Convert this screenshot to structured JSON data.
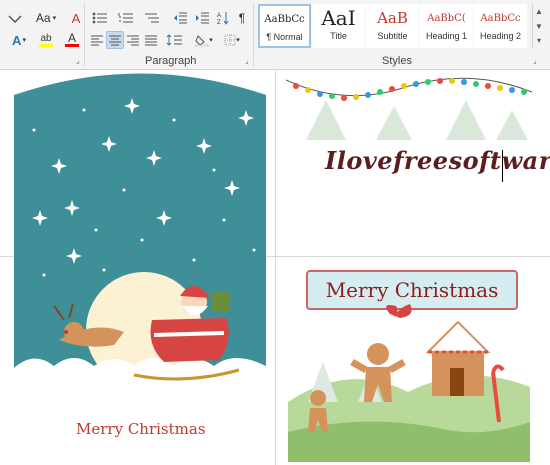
{
  "ribbon": {
    "font": {
      "change_case": "Aa",
      "clear_format_label": "A",
      "text_effects_label": "A",
      "highlight_label": "ab",
      "font_color_label": "A"
    },
    "paragraph": {
      "label": "Paragraph",
      "show_marks": "¶"
    },
    "styles": {
      "label": "Styles",
      "items": [
        {
          "preview": "AaBbCc",
          "name": "¶ Normal"
        },
        {
          "preview": "AaI",
          "name": "Title"
        },
        {
          "preview": "AaB",
          "name": "Subtitle"
        },
        {
          "preview": "AaBbC(",
          "name": "Heading 1"
        },
        {
          "preview": "AaBbCc",
          "name": "Heading 2"
        }
      ]
    }
  },
  "document": {
    "typed_text": "Ilovefreesoftware",
    "front_card": {
      "title": "Merry Christmas"
    },
    "inside_card": {
      "banner": "Merry Christmas"
    }
  },
  "colors": {
    "accent_selected": "#9cc3e5",
    "card_teal": "#3f8f99",
    "card_red": "#c0392b",
    "highlight_yellow": "#ffff00",
    "font_color_red": "#ff0000"
  }
}
